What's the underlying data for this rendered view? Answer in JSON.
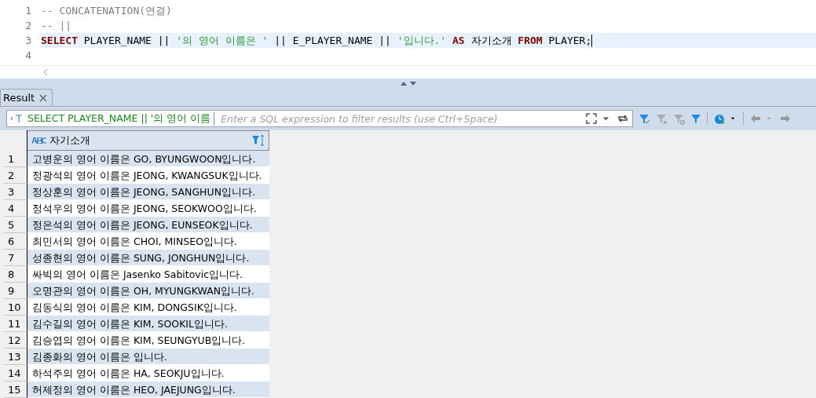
{
  "editor": {
    "lines": [
      {
        "number": "1",
        "current": false,
        "tokens": [
          {
            "kind": "comment",
            "text": "-- CONCATENATION(연결)"
          }
        ]
      },
      {
        "number": "2",
        "current": false,
        "tokens": [
          {
            "kind": "comment",
            "text": "-- ||"
          }
        ]
      },
      {
        "number": "3",
        "current": true,
        "tokens": [
          {
            "kind": "keyword",
            "text": "SELECT"
          },
          {
            "kind": "plain",
            "text": " PLAYER_NAME || "
          },
          {
            "kind": "string",
            "text": "'의 영어 이름은 '"
          },
          {
            "kind": "plain",
            "text": " || E_PLAYER_NAME || "
          },
          {
            "kind": "string",
            "text": "'입니다.'"
          },
          {
            "kind": "keyword",
            "text": " AS"
          },
          {
            "kind": "plain",
            "text": " 자기소개 "
          },
          {
            "kind": "keyword",
            "text": "FROM"
          },
          {
            "kind": "plain",
            "text": " PLAYER;"
          }
        ]
      },
      {
        "number": "4",
        "current": false
      }
    ]
  },
  "tabs": [
    {
      "label": "Result",
      "selected": true
    }
  ],
  "filter": {
    "query": "SELECT PLAYER_NAME || '의 영어 이름",
    "placeholder": "Enter a SQL expression to filter results (use Ctrl+Space)"
  },
  "table": {
    "columns": [
      "자기소개"
    ],
    "rows": [
      {
        "number": "1",
        "value": "고병운의 영어 이름은 GO, BYUNGWOON입니다."
      },
      {
        "number": "2",
        "value": "정광석의 영어 이름은 JEONG, KWANGSUK입니다."
      },
      {
        "number": "3",
        "value": "정상훈의 영어 이름은 JEONG, SANGHUN입니다."
      },
      {
        "number": "4",
        "value": "정석우의 영어 이름은 JEONG, SEOKWOO입니다."
      },
      {
        "number": "5",
        "value": "정은석의 영어 이름은 JEONG, EUNSEOK입니다."
      },
      {
        "number": "6",
        "value": "최민서의 영어 이름은 CHOI, MINSEO입니다."
      },
      {
        "number": "7",
        "value": "성종현의 영어 이름은 SUNG, JONGHUN입니다."
      },
      {
        "number": "8",
        "value": "싸빅의 영어 이름은 Jasenko Sabitovic입니다."
      },
      {
        "number": "9",
        "value": "오명관의 영어 이름은 OH, MYUNGKWAN입니다."
      },
      {
        "number": "10",
        "value": "김동식의 영어 이름은 KIM, DONGSIK입니다."
      },
      {
        "number": "11",
        "value": "김수길의 영어 이름은 KIM, SOOKIL입니다."
      },
      {
        "number": "12",
        "value": "김승엽의 영어 이름은 KIM, SEUNGYUB입니다."
      },
      {
        "number": "13",
        "value": "김종화의 영어 이름은 입니다."
      },
      {
        "number": "14",
        "value": "하석주의 영어 이름은 HA, SEOKJU입니다."
      },
      {
        "number": "15",
        "value": "허제정의 영어 이름은 HEO, JAEJUNG입니다."
      }
    ]
  }
}
